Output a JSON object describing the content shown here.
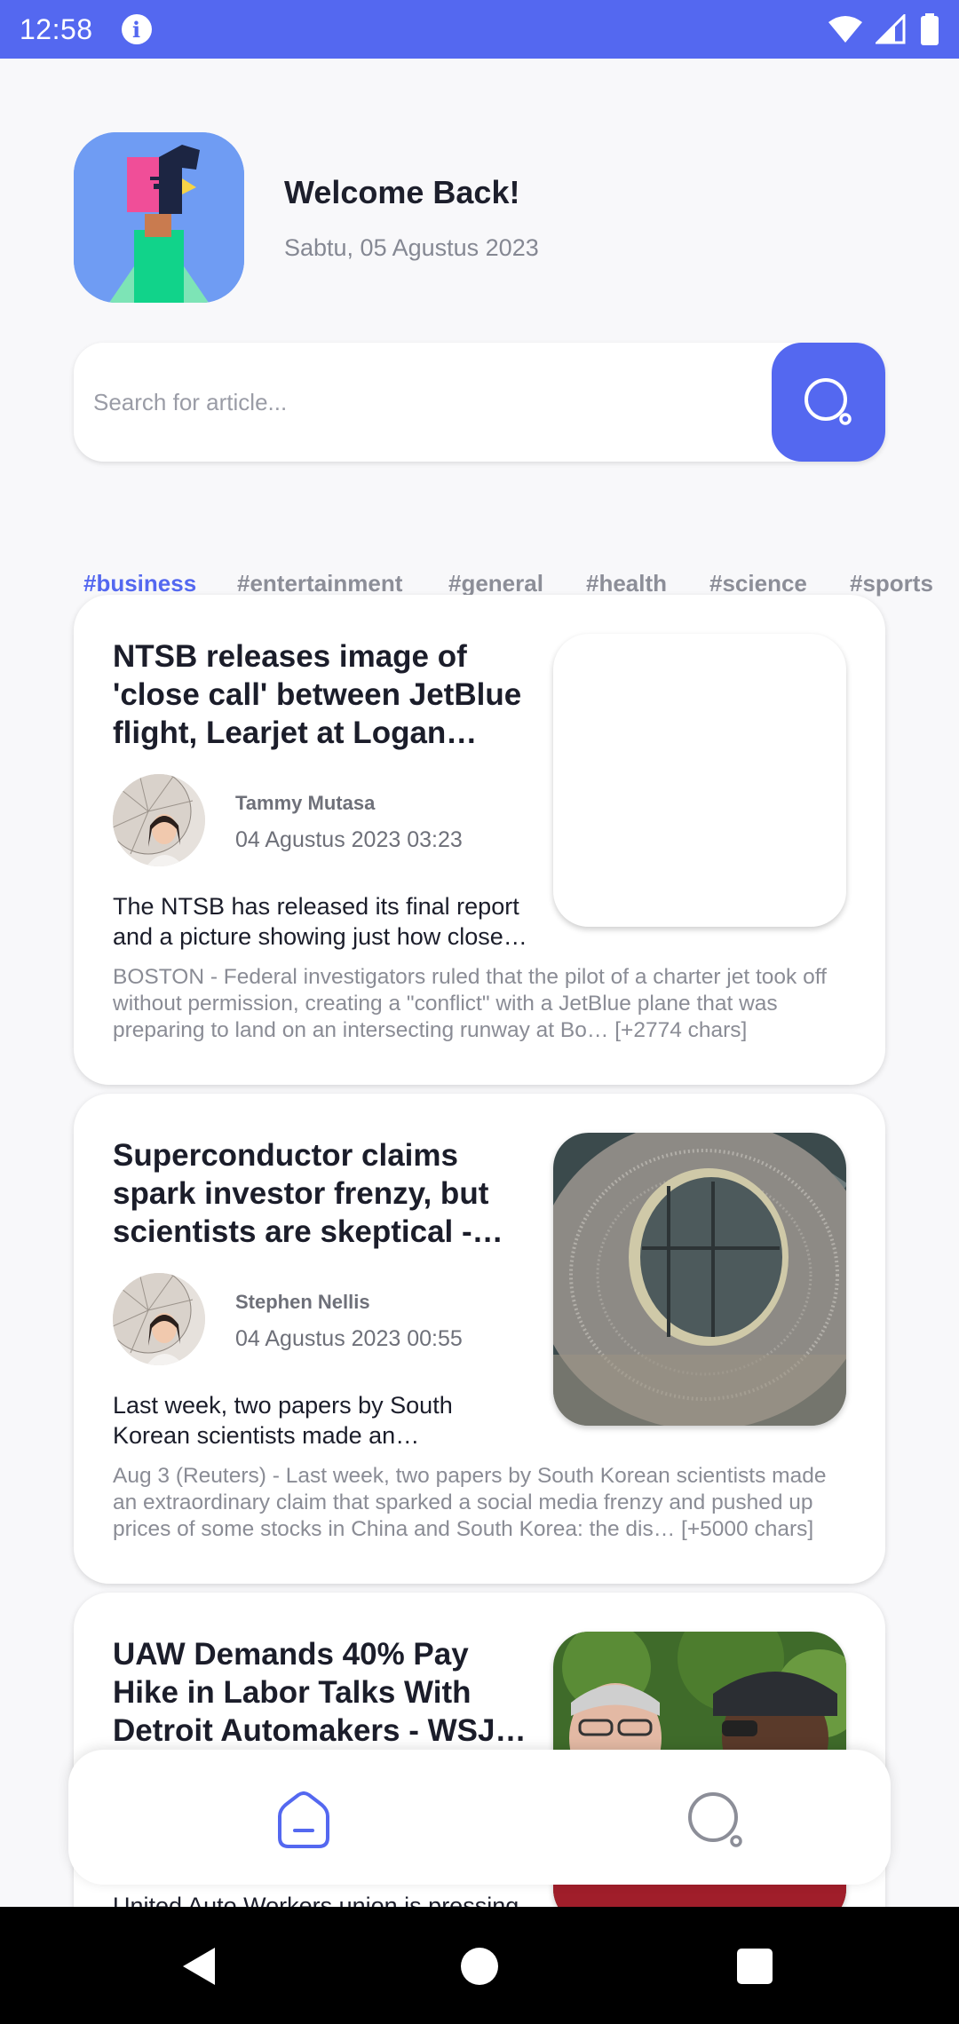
{
  "status_bar": {
    "time": "12:58",
    "info_icon": "i",
    "icons": [
      "wifi-icon",
      "signal-icon",
      "battery-icon"
    ]
  },
  "header": {
    "title": "Welcome Back!",
    "date": "Sabtu, 05 Agustus 2023"
  },
  "search": {
    "placeholder": "Search for article...",
    "value": ""
  },
  "tags": [
    {
      "label": "#business",
      "active": true
    },
    {
      "label": "#entertainment",
      "active": false
    },
    {
      "label": "#general",
      "active": false
    },
    {
      "label": "#health",
      "active": false
    },
    {
      "label": "#science",
      "active": false
    },
    {
      "label": "#sports",
      "active": false
    }
  ],
  "articles": [
    {
      "title": "NTSB releases image of 'close call' between JetBlue flight, Learjet at Logan Airport",
      "author": "Tammy Mutasa",
      "date": "04 Agustus 2023 03:23",
      "description": "The NTSB has released its final report and a picture showing just how close the two planes came",
      "content": "BOSTON - Federal investigators ruled that the pilot of a charter jet took off without permission, creating a \"conflict\" with a JetBlue plane that was preparing to land on an intersecting runway at Bo… [+2774 chars]"
    },
    {
      "title": "Superconductor claims spark investor frenzy, but scientists are skeptical - Reuters",
      "author": "Stephen Nellis",
      "date": "04 Agustus 2023 00:55",
      "description": "Last week, two papers by South Korean scientists made an extraordinary claim",
      "content": "Aug 3 (Reuters) - Last week, two papers by South Korean scientists made an extraordinary claim that sparked a social media frenzy and pushed up prices of some stocks in China and South Korea: the dis… [+5000 chars]"
    },
    {
      "title": "UAW Demands 40% Pay Hike in Labor Talks With Detroit Automakers - WSJ - The Wall Street Journal",
      "author": "",
      "date": "",
      "description": "United Auto Workers union is pressing",
      "content": ""
    }
  ],
  "colors": {
    "accent": "#5468f0",
    "background": "#f8f8fa",
    "text": "#1b1d2a",
    "muted": "#858893"
  },
  "bottom_nav": [
    "home-icon",
    "search-icon"
  ]
}
